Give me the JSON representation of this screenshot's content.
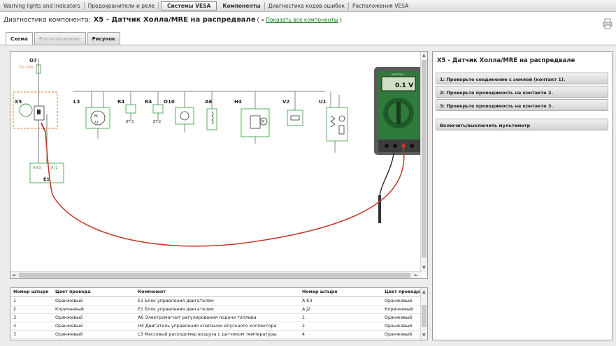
{
  "menu": {
    "items": [
      {
        "label": "Warning lights and indicators",
        "style": "normal"
      },
      {
        "label": "Предохранители и реле",
        "style": "normal"
      },
      {
        "label": "Системы VESA",
        "style": "boxed"
      },
      {
        "label": "Компоненты",
        "style": "bold"
      },
      {
        "label": "Диагностика кодов ошибок",
        "style": "normal"
      },
      {
        "label": "Расположения VESA",
        "style": "normal"
      }
    ]
  },
  "header": {
    "prefix": "Диагностика компонента:",
    "component": "X5 - Датчик Холла/MRE на распредвале",
    "open_paren": "( «",
    "show_all_link": "Показать все компоненты",
    "close_paren": ")"
  },
  "tabs": [
    {
      "label": "Схема",
      "state": "active"
    },
    {
      "label": "Расположение",
      "state": "disabled"
    },
    {
      "label": "Рисунок",
      "state": "normal"
    }
  ],
  "diagram": {
    "labels": {
      "o7": "O7",
      "o7_fuse": "F1-20A",
      "x5": "X5",
      "l3": "L3",
      "r4a": "R4",
      "r4b": "R4",
      "o10": "O10",
      "a6": "A6",
      "h4": "H4",
      "v2": "V2",
      "u1": "U1",
      "e1": "E1",
      "e1_pin_a": "A K3",
      "e1_pin_b": "A J2",
      "r4a_pins": "87  2",
      "r4b_pins": "87  2"
    },
    "multimeter": {
      "reading": "0.1 V",
      "brand": "MASTECH"
    },
    "colors": {
      "wire_green": "#2e9b3a",
      "probe_red": "#c0392b",
      "meter_body": "#2f7a3c",
      "x5_highlight": "#e07b39",
      "wire_orange": "#d4884a"
    }
  },
  "right_panel": {
    "title": "X5 - Датчик Холла/MRE на распредвале",
    "buttons": [
      "1: Проверьте соединение с землей (контакт 1).",
      "2: Проверьте проводимость на контакте 2.",
      "3: Проверьте проводимость на контакте 3.",
      "Включить/выключить мультиметр"
    ]
  },
  "pin_table": {
    "headers": [
      "Номер штыря",
      "Цвет провода",
      "Компонент",
      "Номер штыря",
      "Цвет провода"
    ],
    "rows": [
      [
        "1",
        "Оранжевый",
        "E1 Блок управления двигателем",
        "A K3",
        "Оранжевый"
      ],
      [
        "2",
        "Коричневый",
        "E1 Блок управления двигателем",
        "A J2",
        "Коричневый"
      ],
      [
        "3",
        "Оранжевый",
        "A6 Электромагнит регулирования подачи топлива",
        "1",
        "Оранжевый"
      ],
      [
        "3",
        "Оранжевый",
        "H4 Двигатель управления клапаном впускного коллектора",
        "2",
        "Оранжевый"
      ],
      [
        "3",
        "Оранжевый",
        "L3 Массовый расходомер воздуха с датчиком температуры",
        "4",
        "Оранжевый"
      ]
    ]
  },
  "icons": {
    "print": "print-icon",
    "scroll_up": "▲",
    "scroll_down": "▼",
    "scroll_left": "◄",
    "scroll_right": "►"
  }
}
